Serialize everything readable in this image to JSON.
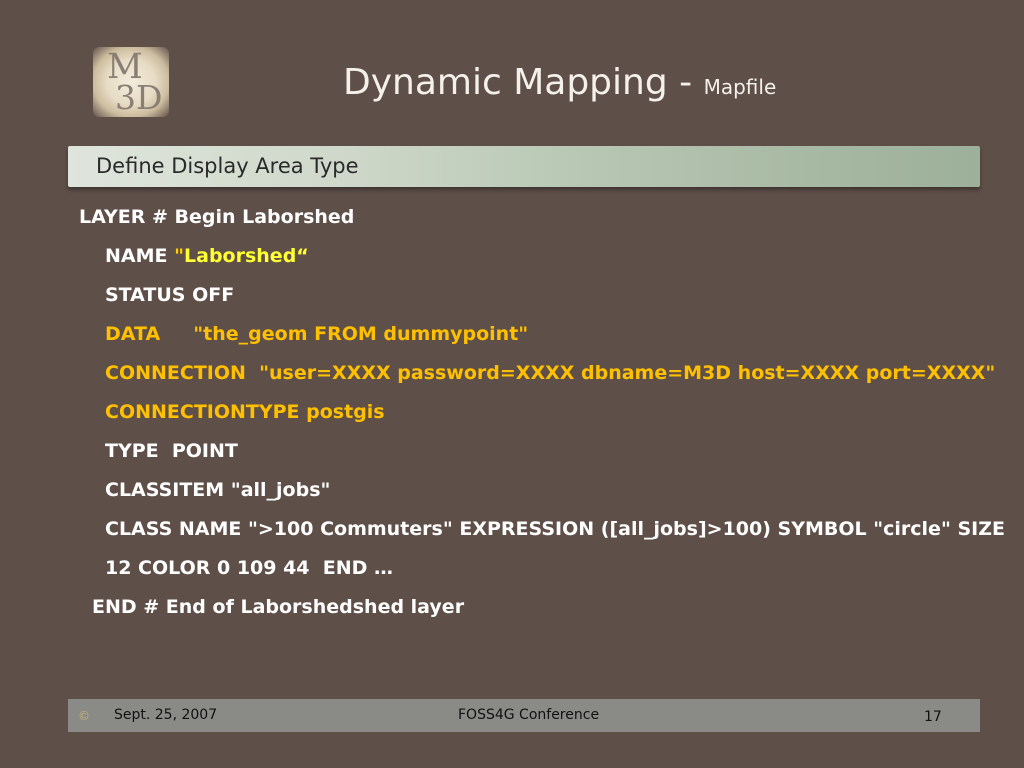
{
  "logo": {
    "top": "M",
    "bottom": "3D"
  },
  "title": {
    "main": "Dynamic Mapping - ",
    "sub": "Mapfile"
  },
  "banner": {
    "text": "Define Display Area Type"
  },
  "code": {
    "l1": "LAYER # Begin Laborshed",
    "l2a": "NAME ",
    "l2b": "\"",
    "l2c": "Laborshed“",
    "l3": "STATUS  OFF",
    "l4": "DATA     \"the_geom FROM dummypoint\"",
    "l5": "CONNECTION  \"user=XXXX password=XXXX dbname=M3D host=XXXX port=XXXX\"",
    "l6": "CONNECTIONTYPE postgis",
    "l7": "TYPE  POINT",
    "l8": "CLASSITEM \"all_jobs\"",
    "l9": "CLASS NAME \">100 Commuters\" EXPRESSION ([all_jobs]>100) SYMBOL \"circle\" SIZE",
    "l10": "12 COLOR 0 109 44  END …",
    "l11": "END # End of Laborshedshed layer"
  },
  "footer": {
    "bullet": "©",
    "date": "Sept. 25, 2007",
    "conference": "FOSS4G Conference",
    "page": "17"
  }
}
